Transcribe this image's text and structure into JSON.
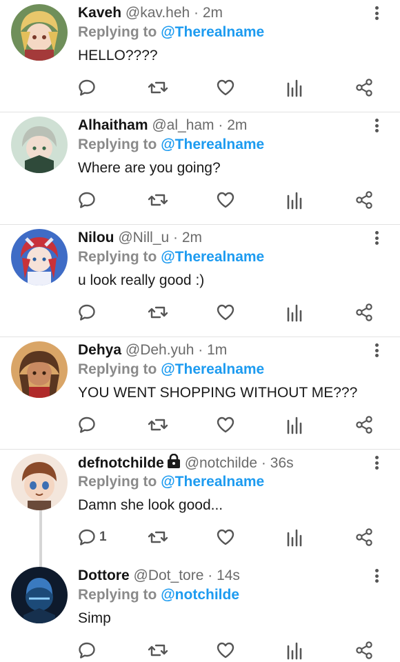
{
  "colors": {
    "accent": "#1d9bf0",
    "name": "#141414",
    "muted": "#6b6b6b",
    "reply": "#8a8a8a"
  },
  "tweets": [
    {
      "name": "Kaveh",
      "handle": "@kav.heh",
      "sep": "·",
      "time": "2m",
      "replying": "Replying to",
      "mention": "@Therealname",
      "text": "HELLO????",
      "reply_count": "",
      "avatar": "blonde-character-avatar"
    },
    {
      "name": "Alhaitham",
      "handle": "@al_ham",
      "sep": "·",
      "time": "2m",
      "replying": "Replying to",
      "mention": "@Therealname",
      "text": "Where are you going?",
      "reply_count": "",
      "avatar": "grey-hair-character-avatar"
    },
    {
      "name": "Nilou",
      "handle": "@Nill_u",
      "sep": "·",
      "time": "2m",
      "replying": "Replying to",
      "mention": "@Therealname",
      "text": "u look really good :)",
      "reply_count": "",
      "avatar": "red-hair-character-avatar"
    },
    {
      "name": "Dehya",
      "handle": "@Deh.yuh",
      "sep": "·",
      "time": "1m",
      "replying": "Replying to",
      "mention": "@Therealname",
      "text": "YOU WENT SHOPPING WITHOUT ME???",
      "reply_count": "",
      "avatar": "brown-hair-character-avatar"
    },
    {
      "name": "defnotchilde",
      "handle": "@notchilde",
      "sep": "·",
      "time": "36s",
      "replying": "Replying to",
      "mention": "@Therealname",
      "text": "Damn she look good...",
      "reply_count": "1",
      "avatar": "orange-hair-character-avatar",
      "locked": true
    },
    {
      "name": "Dottore",
      "handle": "@Dot_tore",
      "sep": "·",
      "time": "14s",
      "replying": "Replying to",
      "mention": "@notchilde",
      "text": "Simp",
      "reply_count": "",
      "avatar": "masked-character-avatar"
    }
  ],
  "icons": [
    "reply-icon",
    "retweet-icon",
    "like-icon",
    "analytics-icon",
    "share-icon",
    "more-icon",
    "lock-icon"
  ]
}
